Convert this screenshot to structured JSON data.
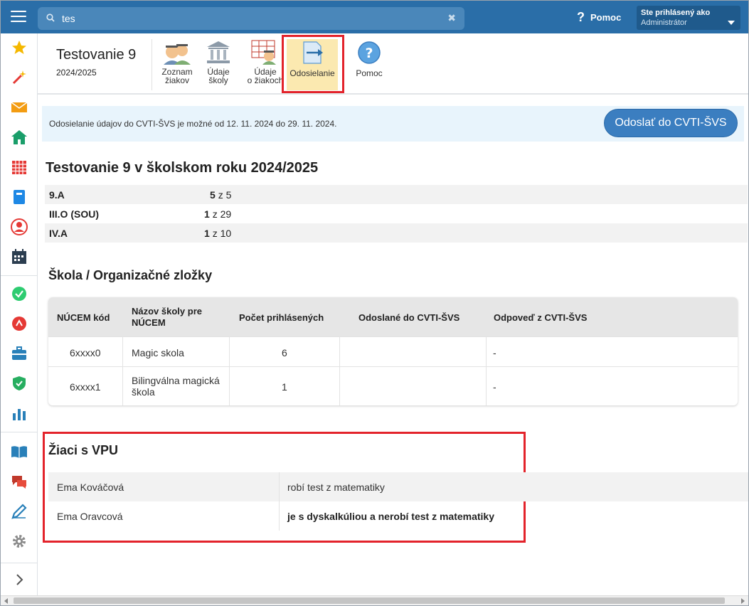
{
  "topbar": {
    "search_value": "tes",
    "help_label": "Pomoc",
    "user_line1": "Ste prihlásený ako",
    "user_line2": "Administrátor"
  },
  "module": {
    "title": "Testovanie 9",
    "year": "2024/2025",
    "tools": [
      {
        "label1": "Zoznam",
        "label2": "žiakov"
      },
      {
        "label1": "Údaje",
        "label2": "školy"
      },
      {
        "label1": "Údaje",
        "label2": "o žiakoch"
      },
      {
        "label1": "Odosielanie",
        "label2": ""
      },
      {
        "label1": "Pomoc",
        "label2": ""
      }
    ]
  },
  "banner": {
    "text": "Odosielanie údajov do CVTI-ŠVS je možné od 12. 11. 2024 do 29. 11. 2024.",
    "button": "Odoslať do CVTI-ŠVS"
  },
  "summary": {
    "heading": "Testovanie 9 v školskom roku 2024/2025",
    "rows": [
      {
        "name": "9.A",
        "count": "5",
        "of": "z 5"
      },
      {
        "name": "III.O (SOU)",
        "count": "1",
        "of": "z 29"
      },
      {
        "name": "IV.A",
        "count": "1",
        "of": "z 10"
      }
    ]
  },
  "school": {
    "heading": "Škola / Organizačné zložky",
    "columns": [
      "NÚCEM kód",
      "Názov školy pre NÚCEM",
      "Počet prihlásených",
      "Odoslané do CVTI-ŠVS",
      "Odpoveď z CVTI-ŠVS"
    ],
    "rows": [
      {
        "code": "6xxxx0",
        "name": "Magic skola",
        "count": "6",
        "sent": "",
        "response": "-"
      },
      {
        "code": "6xxxx1",
        "name": "Bilingválna magická škola",
        "count": "1",
        "sent": "",
        "response": "-"
      }
    ]
  },
  "vpu": {
    "heading": "Žiaci s VPU",
    "rows": [
      {
        "name": "Ema Kováčová",
        "note": "robí test z matematiky"
      },
      {
        "name": "Ema Oravcová",
        "note": "je s dyskalkúliou a nerobí test z matematiky"
      }
    ]
  },
  "colors": {
    "topbar": "#2a6ea8",
    "accent_button": "#3b7ec0",
    "highlight": "#e3232b",
    "active_tool_bg": "#fbe9b0"
  }
}
